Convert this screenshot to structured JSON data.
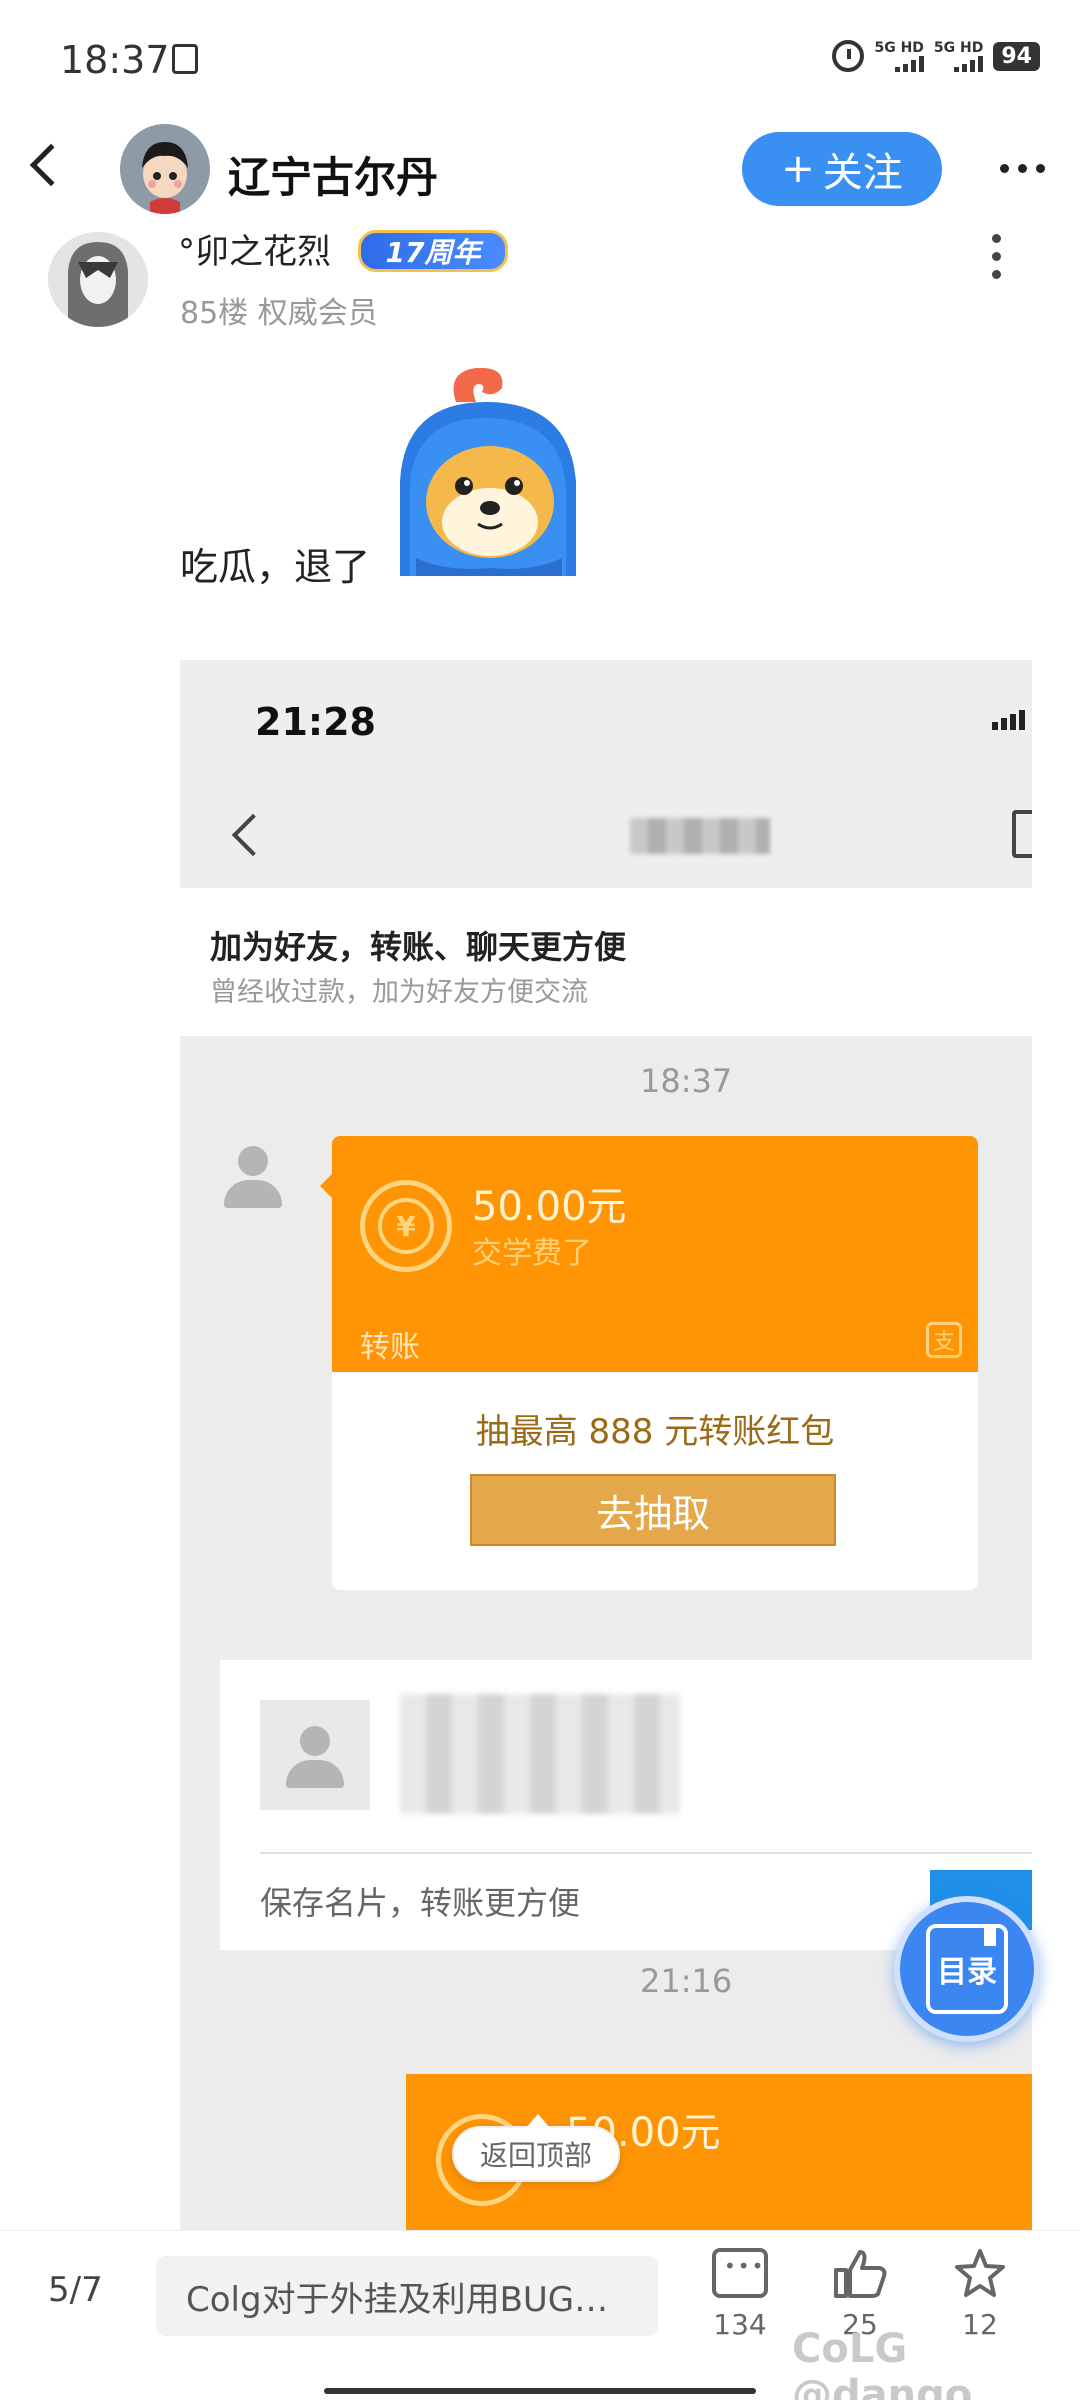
{
  "status_bar": {
    "time": "18:37",
    "sig1": "5G HD",
    "sig2": "5G HD",
    "battery": "94"
  },
  "header": {
    "forum_name": "辽宁古尔丹",
    "follow_label": "关注",
    "follow_plus": "+"
  },
  "post": {
    "username": "°卯之花烈",
    "badge": "17周年",
    "meta": "85楼 权威会员",
    "text": "吃瓜，退了"
  },
  "embedded": {
    "time": "21:28",
    "notice_title": "加为好友，转账、聊天更方便",
    "notice_sub": "曾经收过款，加为好友方便交流",
    "timestamp1": "18:37",
    "amount": "50.00元",
    "memo": "交学费了",
    "card_label": "转账",
    "promo": "抽最高 888 元转账红包",
    "draw_button": "去抽取",
    "save_card": "保存名片，转账更方便",
    "timestamp2": "21:16",
    "amount2": "50.00元"
  },
  "floating": {
    "back_to_top": "返回顶部",
    "toc": "目录"
  },
  "bottom_bar": {
    "page": "5/7",
    "title": "Colg对于外挂及利用BUG…",
    "comments": "134",
    "likes": "25",
    "favorites": "12",
    "watermark": "CoLG @dango"
  },
  "colors": {
    "accent": "#3a8ff2",
    "transfer_orange": "#ff9404",
    "draw_button": "#e4a84a"
  }
}
